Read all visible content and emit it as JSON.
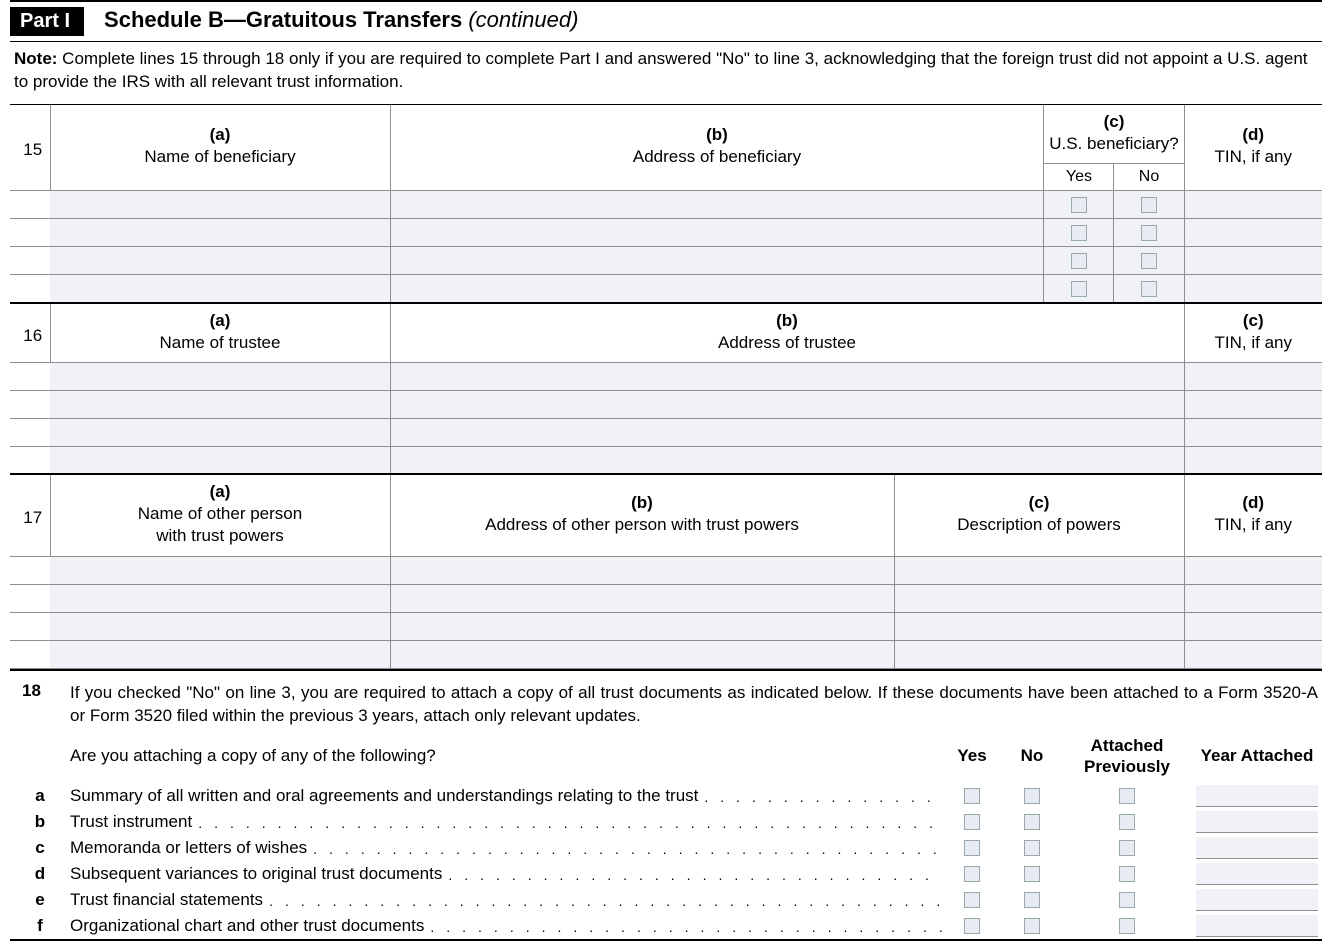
{
  "header": {
    "part_badge": "Part I",
    "title_prefix": "Schedule B—Gratuitous Transfers",
    "title_suffix": " (continued)"
  },
  "note": {
    "label": "Note:",
    "text": " Complete lines 15 through 18 only if you are required to complete Part I and answered \"No\" to line 3, acknowledging that the foreign trust did not appoint a U.S. agent to provide the IRS with all relevant trust information."
  },
  "line15": {
    "num": "15",
    "cols": {
      "a": {
        "letter": "(a)",
        "label": "Name of beneficiary"
      },
      "b": {
        "letter": "(b)",
        "label": "Address of beneficiary"
      },
      "c": {
        "letter": "(c)",
        "label": "U.S. beneficiary?",
        "yes": "Yes",
        "no": "No"
      },
      "d": {
        "letter": "(d)",
        "label": "TIN, if any"
      }
    },
    "rows": [
      {
        "name": "",
        "address": "",
        "us_yes": false,
        "us_no": false,
        "tin": ""
      },
      {
        "name": "",
        "address": "",
        "us_yes": false,
        "us_no": false,
        "tin": ""
      },
      {
        "name": "",
        "address": "",
        "us_yes": false,
        "us_no": false,
        "tin": ""
      },
      {
        "name": "",
        "address": "",
        "us_yes": false,
        "us_no": false,
        "tin": ""
      }
    ]
  },
  "line16": {
    "num": "16",
    "cols": {
      "a": {
        "letter": "(a)",
        "label": "Name of trustee"
      },
      "b": {
        "letter": "(b)",
        "label": "Address of trustee"
      },
      "c": {
        "letter": "(c)",
        "label": "TIN, if any"
      }
    },
    "rows": [
      {
        "name": "",
        "address": "",
        "tin": ""
      },
      {
        "name": "",
        "address": "",
        "tin": ""
      },
      {
        "name": "",
        "address": "",
        "tin": ""
      },
      {
        "name": "",
        "address": "",
        "tin": ""
      }
    ]
  },
  "line17": {
    "num": "17",
    "cols": {
      "a": {
        "letter": "(a)",
        "label": "Name of other person\nwith trust powers"
      },
      "b": {
        "letter": "(b)",
        "label": "Address of other person with trust powers"
      },
      "c": {
        "letter": "(c)",
        "label": "Description of powers"
      },
      "d": {
        "letter": "(d)",
        "label": "TIN, if any"
      }
    },
    "rows": [
      {
        "name": "",
        "address": "",
        "desc": "",
        "tin": ""
      },
      {
        "name": "",
        "address": "",
        "desc": "",
        "tin": ""
      },
      {
        "name": "",
        "address": "",
        "desc": "",
        "tin": ""
      },
      {
        "name": "",
        "address": "",
        "desc": "",
        "tin": ""
      }
    ]
  },
  "line18": {
    "num": "18",
    "intro": "If you checked \"No\" on line 3, you are required to attach a copy of all trust documents as indicated below. If these documents have been attached to a Form 3520-A or Form 3520 filed within the previous 3 years, attach only relevant updates.",
    "question": "Are you attaching a copy of any of the following?",
    "headers": {
      "yes": "Yes",
      "no": "No",
      "prev": "Attached Previously",
      "year": "Year Attached"
    },
    "items": [
      {
        "letter": "a",
        "text": "Summary of all written and oral agreements and understandings relating to the trust",
        "yes": false,
        "no": false,
        "prev": false,
        "year": ""
      },
      {
        "letter": "b",
        "text": "Trust instrument",
        "yes": false,
        "no": false,
        "prev": false,
        "year": ""
      },
      {
        "letter": "c",
        "text": "Memoranda or letters of wishes",
        "yes": false,
        "no": false,
        "prev": false,
        "year": ""
      },
      {
        "letter": "d",
        "text": "Subsequent variances to original trust documents",
        "yes": false,
        "no": false,
        "prev": false,
        "year": ""
      },
      {
        "letter": "e",
        "text": "Trust financial statements",
        "yes": false,
        "no": false,
        "prev": false,
        "year": ""
      },
      {
        "letter": "f",
        "text": "Organizational chart and other trust documents",
        "yes": false,
        "no": false,
        "prev": false,
        "year": ""
      }
    ]
  }
}
